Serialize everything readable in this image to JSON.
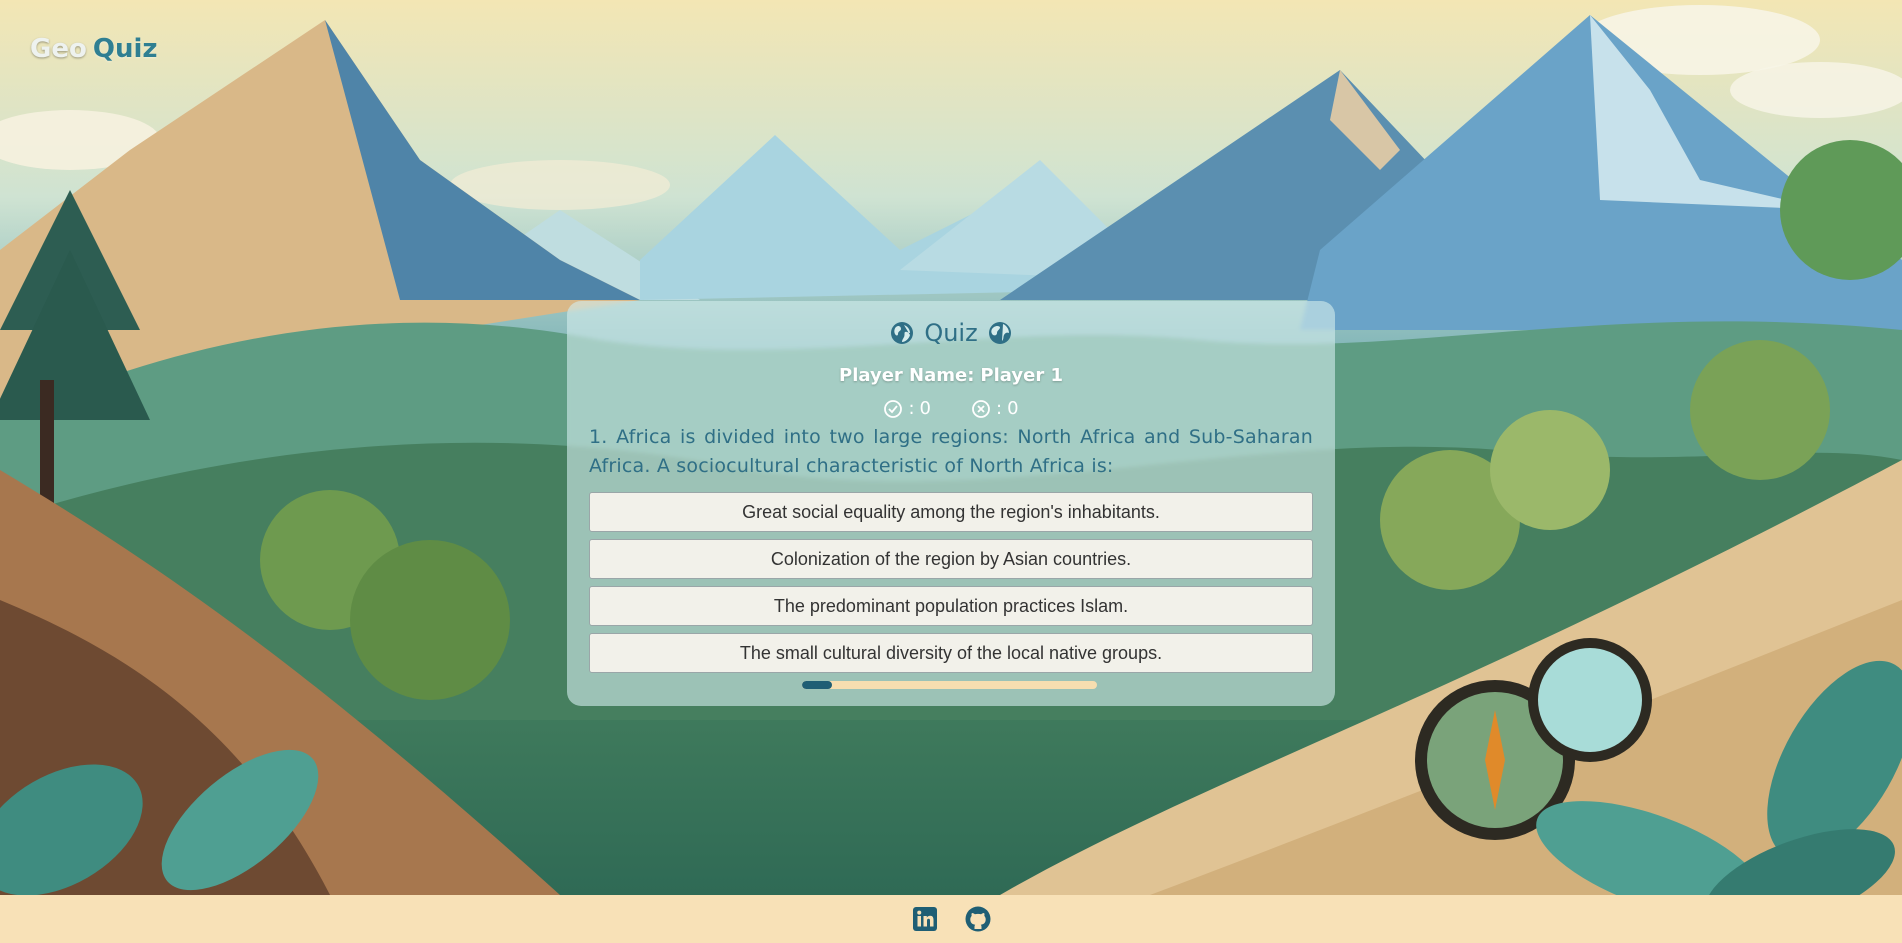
{
  "header": {
    "logo_geo": "Geo",
    "logo_quiz": "Quiz"
  },
  "quiz": {
    "title": "Quiz",
    "player_label": "Player Name:",
    "player_name": "Player 1",
    "correct_count": "0",
    "wrong_count": "0",
    "question": "1. Africa is divided into two large regions: North Africa and Sub-Saharan Africa. A sociocultural characteristic of North Africa is:",
    "answers": [
      "Great social equality among the region's inhabitants.",
      "Colonization of the region by Asian countries.",
      "The predominant population practices Islam.",
      "The small cultural diversity of the local native groups."
    ],
    "progress_fraction": 0.1
  },
  "footer": {
    "icons": [
      "linkedin-icon",
      "github-icon"
    ]
  },
  "colors": {
    "accent": "#2f6f86",
    "footer_bg": "#f8e1b7",
    "progress_track": "#f7deb0",
    "progress_fill": "#1f5e74"
  }
}
